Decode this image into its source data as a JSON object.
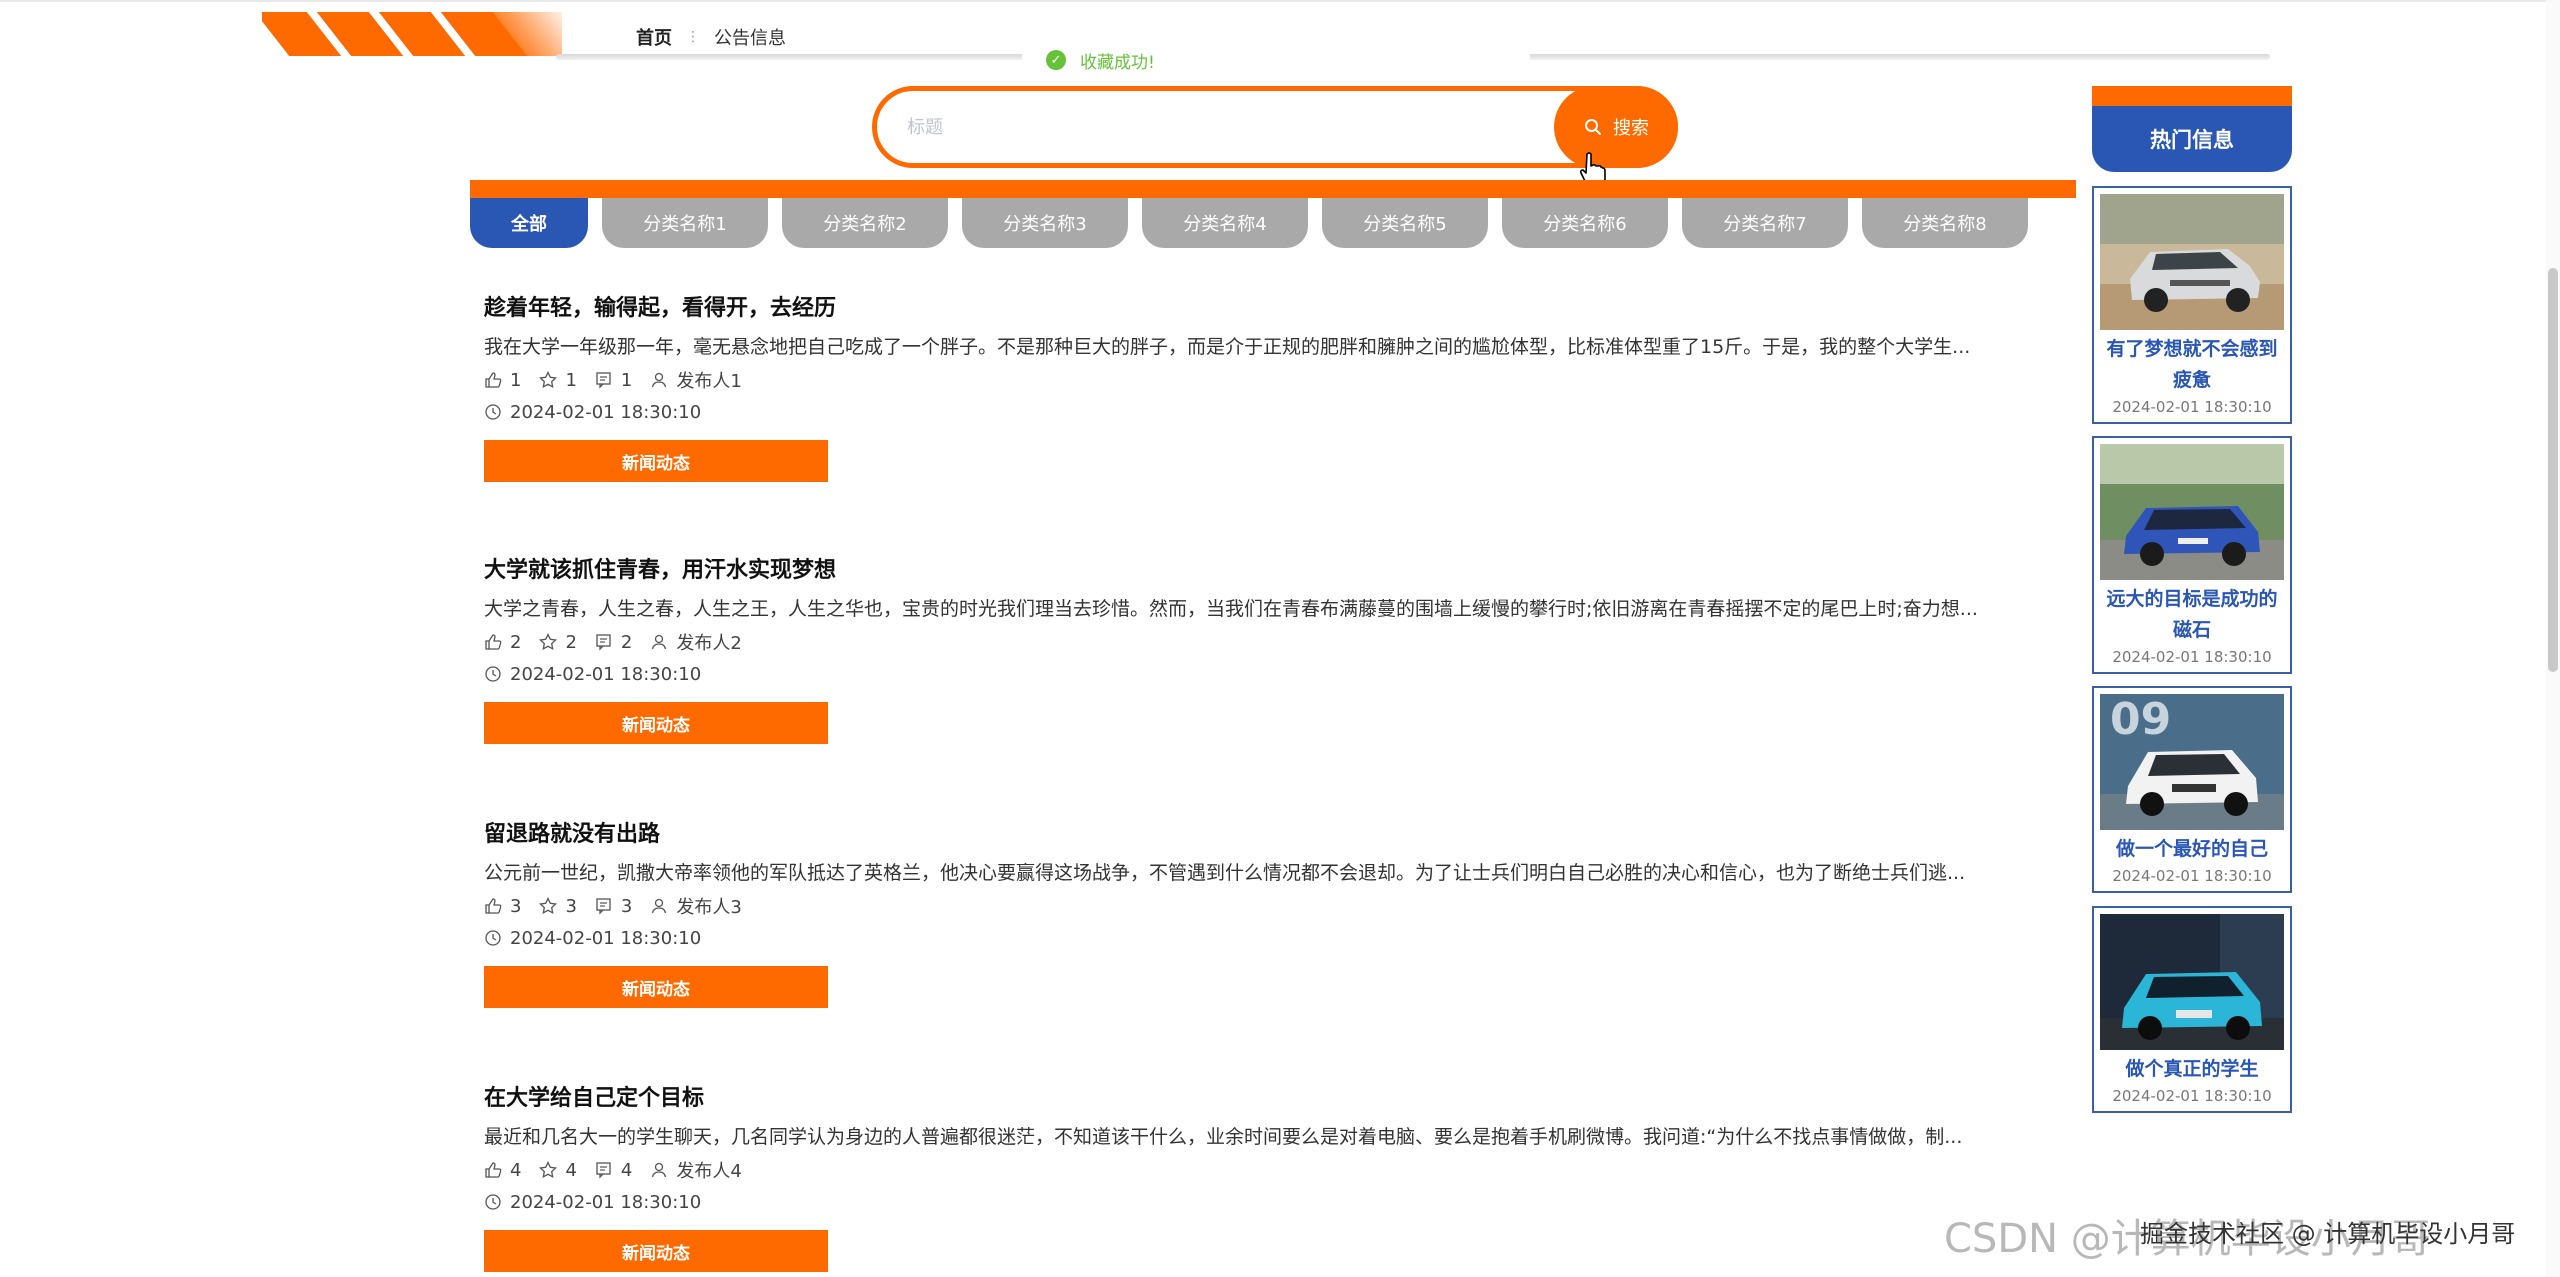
{
  "header": {
    "breadcrumb_home": "首页",
    "breadcrumb_sep": "⋮",
    "breadcrumb_current": "公告信息"
  },
  "toast": {
    "message": "收藏成功!",
    "type": "success",
    "color": "#67c23a"
  },
  "search": {
    "placeholder": "标题",
    "value": "",
    "button_label": "搜索"
  },
  "tabs": [
    {
      "label": "全部",
      "active": true
    },
    {
      "label": "分类名称1",
      "active": false
    },
    {
      "label": "分类名称2",
      "active": false
    },
    {
      "label": "分类名称3",
      "active": false
    },
    {
      "label": "分类名称4",
      "active": false
    },
    {
      "label": "分类名称5",
      "active": false
    },
    {
      "label": "分类名称6",
      "active": false
    },
    {
      "label": "分类名称7",
      "active": false
    },
    {
      "label": "分类名称8",
      "active": false
    }
  ],
  "news": [
    {
      "title": "趁着年轻，输得起，看得开，去经历",
      "summary": "我在大学一年级那一年，毫无悬念地把自己吃成了一个胖子。不是那种巨大的胖子，而是介于正规的肥胖和臃肿之间的尴尬体型，比标准体型重了15斤。于是，我的整个大学生...",
      "likes": "1",
      "favorites": "1",
      "comments": "1",
      "publisher": "发布人1",
      "time": "2024-02-01 18:30:10",
      "tag": "新闻动态"
    },
    {
      "title": "大学就该抓住青春，用汗水实现梦想",
      "summary": "大学之青春，人生之春，人生之王，人生之华也，宝贵的时光我们理当去珍惜。然而，当我们在青春布满藤蔓的围墙上缓慢的攀行时;依旧游离在青春摇摆不定的尾巴上时;奋力想...",
      "likes": "2",
      "favorites": "2",
      "comments": "2",
      "publisher": "发布人2",
      "time": "2024-02-01 18:30:10",
      "tag": "新闻动态"
    },
    {
      "title": "留退路就没有出路",
      "summary": "公元前一世纪，凯撒大帝率领他的军队抵达了英格兰，他决心要赢得这场战争，不管遇到什么情况都不会退却。为了让士兵们明白自己必胜的决心和信心，也为了断绝士兵们逃...",
      "likes": "3",
      "favorites": "3",
      "comments": "3",
      "publisher": "发布人3",
      "time": "2024-02-01 18:30:10",
      "tag": "新闻动态"
    },
    {
      "title": "在大学给自己定个目标",
      "summary": "最近和几名大一的学生聊天，几名同学认为身边的人普遍都很迷茫，不知道该干什么，业余时间要么是对着电脑、要么是抱着手机刷微博。我问道:“为什么不找点事情做做，制...",
      "likes": "4",
      "favorites": "4",
      "comments": "4",
      "publisher": "发布人4",
      "time": "2024-02-01 18:30:10",
      "tag": "新闻动态"
    }
  ],
  "hot": {
    "title": "热门信息",
    "items": [
      {
        "caption": "有了梦想就不会感到疲惫",
        "date": "2024-02-01 18:30:10",
        "image": "silver-suv-photo"
      },
      {
        "caption": "远大的目标是成功的磁石",
        "date": "2024-02-01 18:30:10",
        "image": "blue-sedan-photo"
      },
      {
        "caption": "做一个最好的自己",
        "date": "2024-02-01 18:30:10",
        "image": "white-suv-photo"
      },
      {
        "caption": "做个真正的学生",
        "date": "2024-02-01 18:30:10",
        "image": "cyan-suv-photo"
      }
    ]
  },
  "watermark": {
    "main": "CSDN @计算机毕设小月哥",
    "overlay": "掘金技术社区 @ 计算机毕设小月哥"
  },
  "colors": {
    "accent": "#ff6a00",
    "primary": "#2a57b3",
    "tab_inactive": "#a9a9a9",
    "success": "#67c23a"
  }
}
